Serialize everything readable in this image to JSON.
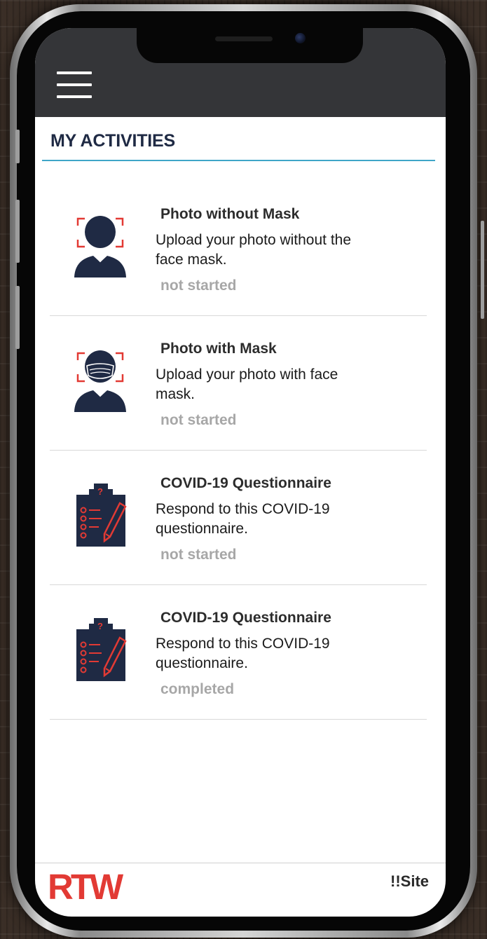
{
  "header": {
    "menu_icon": "hamburger-menu-icon",
    "title": "MY ACTIVITIES"
  },
  "activities": [
    {
      "icon": "face-scan-no-mask-icon",
      "title": "Photo without Mask",
      "description": "Upload your photo without the face mask.",
      "status": "not started"
    },
    {
      "icon": "face-scan-with-mask-icon",
      "title": "Photo with Mask",
      "description": "Upload your photo with face mask.",
      "status": "not started"
    },
    {
      "icon": "clipboard-questionnaire-icon",
      "title": "COVID-19 Questionnaire",
      "description": "Respond to this COVID-19 questionnaire.",
      "status": "not started"
    },
    {
      "icon": "clipboard-questionnaire-icon",
      "title": "COVID-19 Questionnaire",
      "description": "Respond to this COVID-19 questionnaire.",
      "status": "completed"
    }
  ],
  "footer": {
    "logo": "RTW",
    "site_link": "!!Site"
  },
  "colors": {
    "header_bg": "#343538",
    "heading_text": "#1f2a44",
    "divider_accent": "#3fa6c8",
    "icon_navy": "#1f2a44",
    "icon_accent": "#e23a34",
    "status_text": "#a7a7a7",
    "logo": "#e23a34"
  }
}
